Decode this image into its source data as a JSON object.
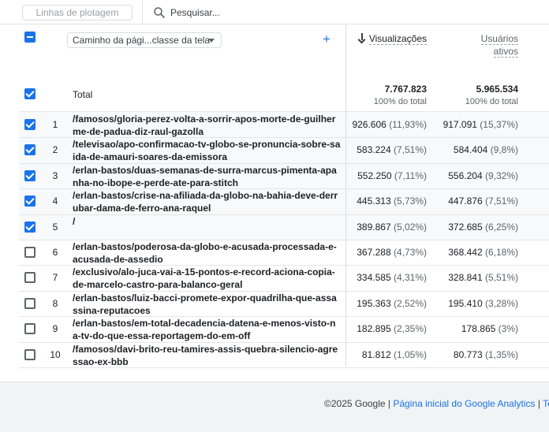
{
  "toolbar": {
    "plot_lines_label": "Linhas de plotagem",
    "search_placeholder": "Pesquisar..."
  },
  "table": {
    "dimension_label": "Caminho da pági...classe da tela",
    "columns": [
      {
        "label": "Visualizações",
        "sorted": true
      },
      {
        "label_line1": "Usuários",
        "label_line2": "ativos"
      }
    ],
    "total": {
      "label": "Total",
      "views": "7.767.823",
      "views_pct": "100% do total",
      "users": "5.965.534",
      "users_pct": "100% do total"
    },
    "rows": [
      {
        "idx": "1",
        "checked": true,
        "path": "/famosos/gloria-perez-volta-a-sorrir-apos-morte-de-guilherme-de-padua-diz-raul-gazolla",
        "views": "926.606",
        "views_pct": "(11,93%)",
        "users": "917.091",
        "users_pct": "(15,37%)"
      },
      {
        "idx": "2",
        "checked": true,
        "path": "/televisao/apo-confirmacao-tv-globo-se-pronuncia-sobre-saida-de-amauri-soares-da-emissora",
        "views": "583.224",
        "views_pct": "(7,51%)",
        "users": "584.404",
        "users_pct": "(9,8%)"
      },
      {
        "idx": "3",
        "checked": true,
        "path": "/erlan-bastos/duas-semanas-de-surra-marcus-pimenta-apanha-no-ibope-e-perde-ate-para-stitch",
        "views": "552.250",
        "views_pct": "(7,11%)",
        "users": "556.204",
        "users_pct": "(9,32%)"
      },
      {
        "idx": "4",
        "checked": true,
        "path": "/erlan-bastos/crise-na-afiliada-da-globo-na-bahia-deve-derrubar-dama-de-ferro-ana-raquel",
        "views": "445.313",
        "views_pct": "(5,73%)",
        "users": "447.876",
        "users_pct": "(7,51%)"
      },
      {
        "idx": "5",
        "checked": true,
        "path": "/",
        "views": "389.867",
        "views_pct": "(5,02%)",
        "users": "372.685",
        "users_pct": "(6,25%)"
      },
      {
        "idx": "6",
        "checked": false,
        "path": "/erlan-bastos/poderosa-da-globo-e-acusada-processada-e-acusada-de-assedio",
        "views": "367.288",
        "views_pct": "(4,73%)",
        "users": "368.442",
        "users_pct": "(6,18%)"
      },
      {
        "idx": "7",
        "checked": false,
        "path": "/exclusivo/alo-juca-vai-a-15-pontos-e-record-aciona-copia-de-marcelo-castro-para-balanco-geral",
        "views": "334.585",
        "views_pct": "(4,31%)",
        "users": "328.841",
        "users_pct": "(5,51%)"
      },
      {
        "idx": "8",
        "checked": false,
        "path": "/erlan-bastos/luiz-bacci-promete-expor-quadrilha-que-assassina-reputacoes",
        "views": "195.363",
        "views_pct": "(2,52%)",
        "users": "195.410",
        "users_pct": "(3,28%)"
      },
      {
        "idx": "9",
        "checked": false,
        "path": "/erlan-bastos/em-total-decadencia-datena-e-menos-visto-na-tv-do-que-essa-reportagem-do-em-off",
        "views": "182.895",
        "views_pct": "(2,35%)",
        "users": "178.865",
        "users_pct": "(3%)"
      },
      {
        "idx": "10",
        "checked": false,
        "path": "/famosos/davi-brito-reu-tamires-assis-quebra-silencio-agressao-ex-bbb",
        "views": "81.812",
        "views_pct": "(1,05%)",
        "users": "80.773",
        "users_pct": "(1,35%)"
      }
    ]
  },
  "footer": {
    "copyright": "©2025 Google |",
    "link_home": "Página inicial do Google Analytics",
    "sep": "|",
    "link_terms": "Te"
  },
  "colors": {
    "accent": "#1a73e8",
    "row_shade": "#f8f9fa"
  },
  "icons": {
    "search": "search-icon",
    "sort": "arrow-down-icon",
    "add": "plus-icon",
    "dropdown": "caret-down-icon"
  }
}
